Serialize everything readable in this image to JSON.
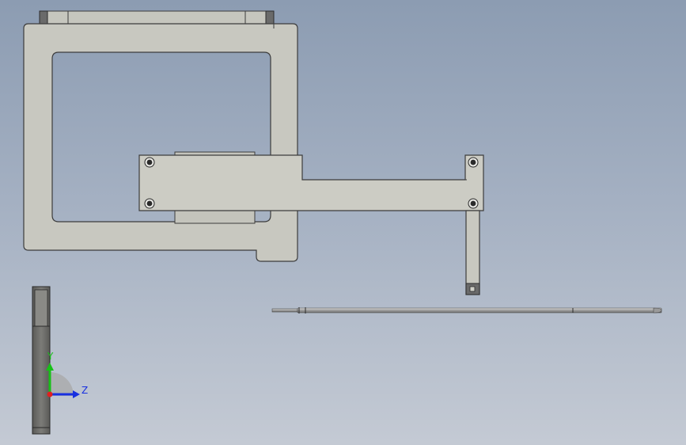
{
  "view": {
    "background_top": "#8c9cb2",
    "background_bottom": "#c4cad4"
  },
  "colors": {
    "part_fill": "#c8c8c0",
    "part_edge": "#3c3c3c",
    "rail_fill": "#9a9a96",
    "dark_cap": "#6a6a6a",
    "rod_fill": "#a8a8a8"
  },
  "triad": {
    "y_label": "Y",
    "z_label": "Z",
    "y_color": "#18c018",
    "z_color": "#1830e0",
    "x_color": "#e02020"
  },
  "parts": {
    "frame": "rectangular-frame",
    "arm": "mounting-arm",
    "post": "vertical-post",
    "rod": "pin-rod",
    "side_view": "side-profile"
  }
}
